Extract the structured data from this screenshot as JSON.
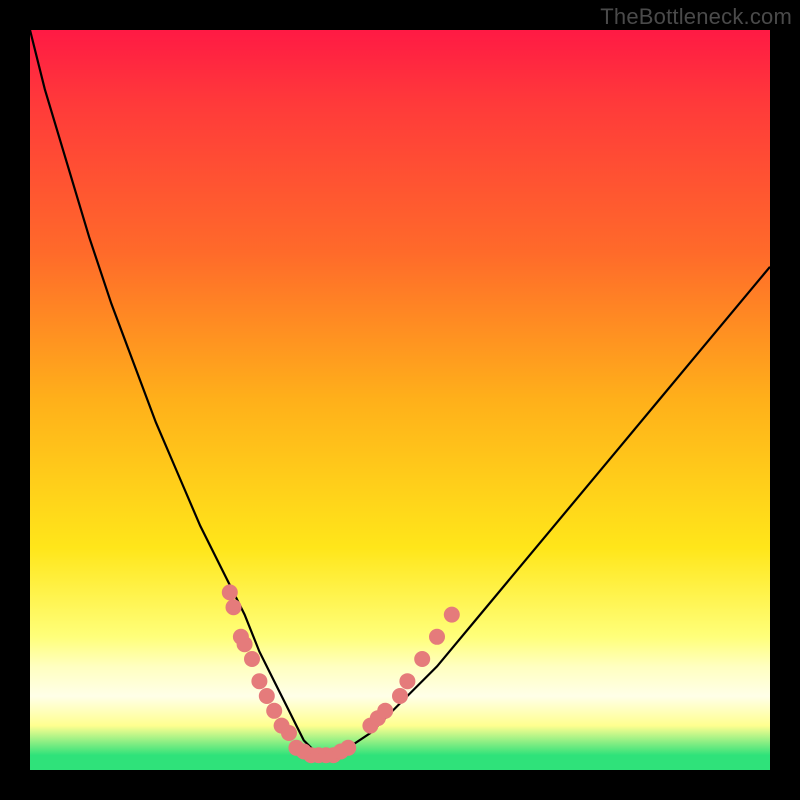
{
  "watermark": "TheBottleneck.com",
  "chart_data": {
    "type": "line",
    "title": "",
    "xlabel": "",
    "ylabel": "",
    "xlim": [
      0,
      100
    ],
    "ylim": [
      0,
      100
    ],
    "grid": false,
    "legend": false,
    "series": [
      {
        "name": "bottleneck-curve",
        "x": [
          0,
          2,
          5,
          8,
          11,
          14,
          17,
          20,
          23,
          26,
          29,
          31,
          33,
          35,
          36,
          37,
          38,
          39,
          40,
          41,
          43,
          46,
          50,
          55,
          60,
          65,
          70,
          75,
          80,
          85,
          90,
          95,
          100
        ],
        "y": [
          100,
          92,
          82,
          72,
          63,
          55,
          47,
          40,
          33,
          27,
          21,
          16,
          12,
          8,
          6,
          4,
          3,
          2,
          2,
          2,
          3,
          5,
          9,
          14,
          20,
          26,
          32,
          38,
          44,
          50,
          56,
          62,
          68
        ]
      }
    ],
    "highlight_clusters": [
      {
        "name": "left-cluster",
        "x": [
          27,
          27.5,
          28.5,
          29,
          30,
          31,
          32,
          33,
          34,
          35
        ],
        "y": [
          24,
          22,
          18,
          17,
          15,
          12,
          10,
          8,
          6,
          5
        ]
      },
      {
        "name": "bottom-cluster",
        "x": [
          36,
          37,
          38,
          39,
          40,
          41,
          42,
          43
        ],
        "y": [
          3,
          2.5,
          2,
          2,
          2,
          2,
          2.5,
          3
        ]
      },
      {
        "name": "right-cluster",
        "x": [
          46,
          47,
          48,
          50,
          51,
          53,
          55,
          57
        ],
        "y": [
          6,
          7,
          8,
          10,
          12,
          15,
          18,
          21
        ]
      }
    ],
    "colors": {
      "curve": "#000000",
      "highlight_fill": "#e57b7b",
      "highlight_stroke": "#c85a5a"
    }
  }
}
